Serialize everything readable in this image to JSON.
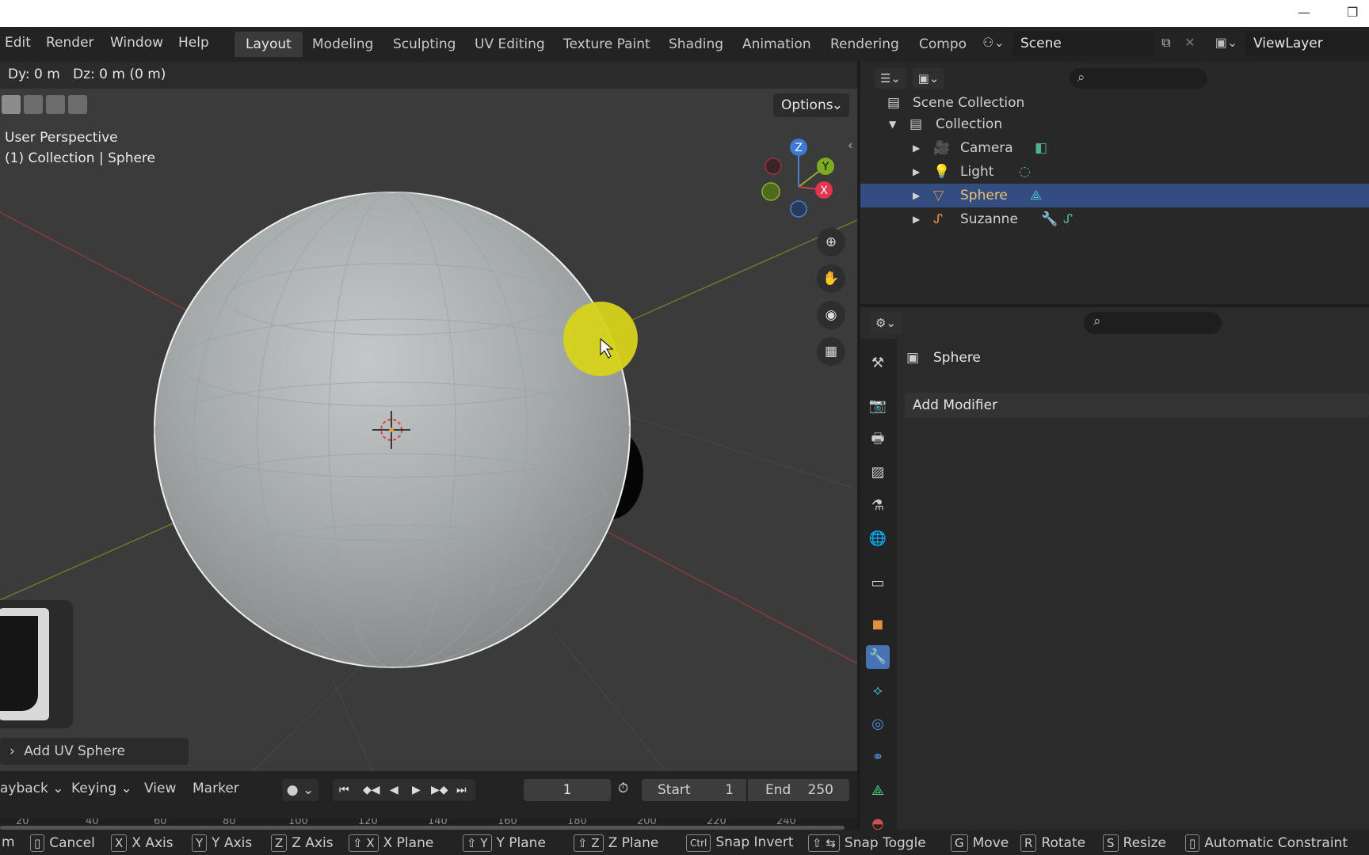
{
  "app": {
    "accent": "#4772b3",
    "selection_color": "#334d80"
  },
  "menu": {
    "items": [
      "Edit",
      "Render",
      "Window",
      "Help"
    ]
  },
  "workspaces": {
    "tabs": [
      "Layout",
      "Modeling",
      "Sculpting",
      "UV Editing",
      "Texture Paint",
      "Shading",
      "Animation",
      "Rendering",
      "Compo"
    ],
    "active": "Layout"
  },
  "scene": {
    "name": "Scene"
  },
  "view_layer": {
    "name": "ViewLayer"
  },
  "viewport": {
    "header_text": "Dy: 0 m   Dz: 0 m (0 m)",
    "options_label": "Options",
    "perspective": "User Perspective",
    "collection_info": "(1) Collection | Sphere",
    "gizmo": {
      "z": "Z",
      "y": "Y",
      "x": "X"
    },
    "redo_panel": "Add UV Sphere"
  },
  "timeline": {
    "playback": "ayback",
    "keying": "Keying",
    "view": "View",
    "marker": "Marker",
    "current_frame": "1",
    "start_label": "Start",
    "start": "1",
    "end_label": "End",
    "end": "250",
    "ruler": [
      "20",
      "40",
      "60",
      "80",
      "100",
      "120",
      "140",
      "160",
      "180",
      "200",
      "220",
      "240"
    ]
  },
  "outliner": {
    "root": "Scene Collection",
    "collection": "Collection",
    "items": [
      "Camera",
      "Light",
      "Sphere",
      "Suzanne"
    ],
    "selected": "Sphere"
  },
  "properties": {
    "object_name": "Sphere",
    "add_modifier": "Add Modifier"
  },
  "statusbar": {
    "items": [
      {
        "key": "",
        "label": "m"
      },
      {
        "key": "mouse",
        "label": "Cancel"
      },
      {
        "key": "X",
        "label": "X Axis"
      },
      {
        "key": "Y",
        "label": "Y Axis"
      },
      {
        "key": "Z",
        "label": "Z Axis"
      },
      {
        "key": "⇧ X",
        "label": "X Plane"
      },
      {
        "key": "⇧ Y",
        "label": "Y Plane"
      },
      {
        "key": "⇧ Z",
        "label": "Z Plane"
      },
      {
        "key": "Ctrl",
        "label": "Snap Invert"
      },
      {
        "key": "⇧ ⇆",
        "label": "Snap Toggle"
      },
      {
        "key": "G",
        "label": "Move"
      },
      {
        "key": "R",
        "label": "Rotate"
      },
      {
        "key": "S",
        "label": "Resize"
      },
      {
        "key": "mouse",
        "label": "Automatic Constraint"
      }
    ]
  }
}
